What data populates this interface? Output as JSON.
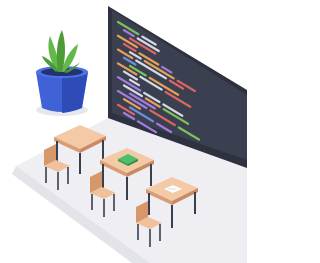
{
  "illustration": {
    "icon": "classroom-coding-illustration",
    "colors": {
      "floor": "#eeeef3",
      "floor_shadow": "#e1e1e8",
      "screen_frame": "#2d3140",
      "screen_face": "#3b4050",
      "plant_pot": "#3f62d6",
      "plant_pot_dark": "#2e4cb8",
      "leaves": "#63b84a",
      "leaves_dark": "#4d9a38",
      "desk_top": "#f3c9a6",
      "desk_edge": "#d99c74",
      "desk_leg": "#3a3f4d",
      "chair": "#f0c19c",
      "chair_dark": "#d6976b",
      "book_green": "#4cbf6a",
      "paper": "#ffffff",
      "code_green": "#7cc35a",
      "code_orange": "#e9a05a",
      "code_red": "#e06464",
      "code_blue": "#6c8fe0",
      "code_white": "#d7dbe6",
      "code_purple": "#a57be0"
    }
  }
}
